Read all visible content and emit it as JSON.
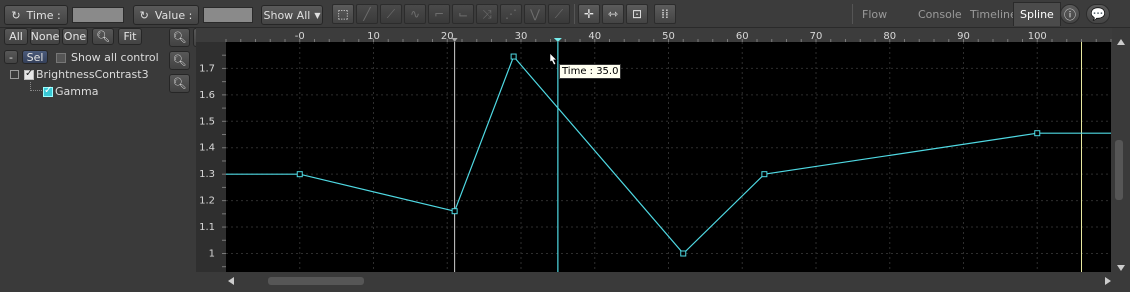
{
  "toolbar": {
    "time_label": "Time :",
    "value_label": "Value :",
    "show_all_label": "Show All",
    "tabs": [
      "Flow",
      "Console",
      "Timeline",
      "Spline"
    ],
    "active_tab": "Spline"
  },
  "left": {
    "all": "All",
    "none": "None",
    "one": "One",
    "fit": "Fit",
    "minus": "-",
    "sel": "Sel",
    "show_all_control": "Show all control",
    "tree_parent": "BrightnessContrast3",
    "tree_child": "Gamma"
  },
  "graph": {
    "x_ticks": [
      "-0",
      "10",
      "20",
      "30",
      "40",
      "50",
      "60",
      "70",
      "80",
      "90",
      "100"
    ],
    "y_ticks": [
      "1.7",
      "1.6",
      "1.5",
      "1.4",
      "1.3",
      "1.2",
      "1.1",
      "1"
    ],
    "tooltip": "Time : 35.0",
    "curve_color": "#4fd9e3",
    "background": "#000000"
  },
  "chart_data": {
    "type": "line",
    "x_range": [
      -10,
      110
    ],
    "y_range": [
      0.93,
      1.8
    ],
    "current_time": 35,
    "marker_lines": [
      21,
      106
    ],
    "series": [
      {
        "points": [
          [
            -10,
            1.3
          ],
          [
            0,
            1.3
          ],
          [
            21,
            1.16
          ],
          [
            29,
            1.745
          ],
          [
            52,
            1.0
          ],
          [
            63,
            1.3
          ],
          [
            100,
            1.455
          ],
          [
            110,
            1.455
          ]
        ]
      }
    ]
  }
}
